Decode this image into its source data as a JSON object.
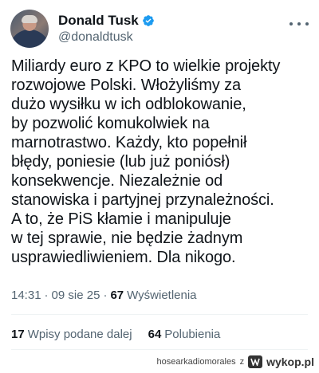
{
  "author": {
    "display_name": "Donald Tusk",
    "handle": "@donaldtusk",
    "verified_icon": "verified-badge-icon"
  },
  "tweet": {
    "text": "Miliardy euro z KPO to wielkie projekty\nrozwojowe Polski. Włożyliśmy za\ndużo wysiłku w ich odblokowanie,\nby pozwolić komukolwiek na\nmarnotrastwo. Każdy, kto popełnił\nbłędy, poniesie (lub już poniósł)\nkonsekwencje. Niezależnie od\nstanowiska i partyjnej przynależności.\nA to, że PiS kłamie i manipuluje\nw tej sprawie, nie będzie żadnym\nusprawiedliwieniem. Dla nikogo."
  },
  "meta": {
    "time": "14:31",
    "separator": "·",
    "date": "09 sie 25",
    "views_count": "67",
    "views_label": "Wyświetlenia"
  },
  "stats": {
    "reposts_count": "17",
    "reposts_label": "Wpisy podane dalej",
    "likes_count": "64",
    "likes_label": "Polubienia"
  },
  "watermark": {
    "user": "hosearkadiomorales",
    "z": "z",
    "site": "wykop.pl"
  },
  "colors": {
    "accent": "#1d9bf0",
    "text": "#0f1419",
    "secondary": "#536471"
  }
}
